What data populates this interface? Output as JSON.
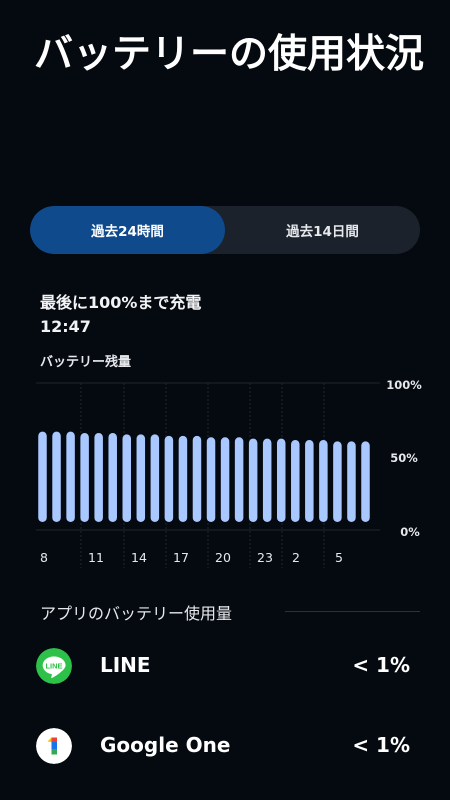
{
  "page": {
    "title": "バッテリーの使用状況"
  },
  "tabs": [
    {
      "label": "過去24時間",
      "active": true
    },
    {
      "label": "過去14日間",
      "active": false
    }
  ],
  "charge": {
    "label": "最後に100%まで充電",
    "time": "12:47"
  },
  "chart_data": {
    "type": "bar",
    "title": "バッテリー残量",
    "y_tick_labels": [
      "100%",
      "50%",
      "0%"
    ],
    "x_tick_labels": [
      "8",
      "11",
      "14",
      "17",
      "20",
      "23",
      "2",
      "5"
    ],
    "ylim": [
      0,
      100
    ],
    "values": [
      65,
      65,
      65,
      64,
      64,
      64,
      63,
      63,
      63,
      62,
      62,
      62,
      61,
      61,
      61,
      60,
      60,
      60,
      59,
      59,
      59,
      58,
      58,
      58
    ],
    "grid": true,
    "bar_color": "#a9c8ff"
  },
  "usage_section": {
    "title": "アプリのバッテリー使用量",
    "apps": [
      {
        "name": "LINE",
        "icon": "line-app-icon",
        "usage": "< 1%",
        "icon_text": "LINE",
        "color": "#2ec14a"
      },
      {
        "name": "Google One",
        "icon": "google-one-icon",
        "usage": "< 1%",
        "icon_text": "1"
      }
    ]
  }
}
